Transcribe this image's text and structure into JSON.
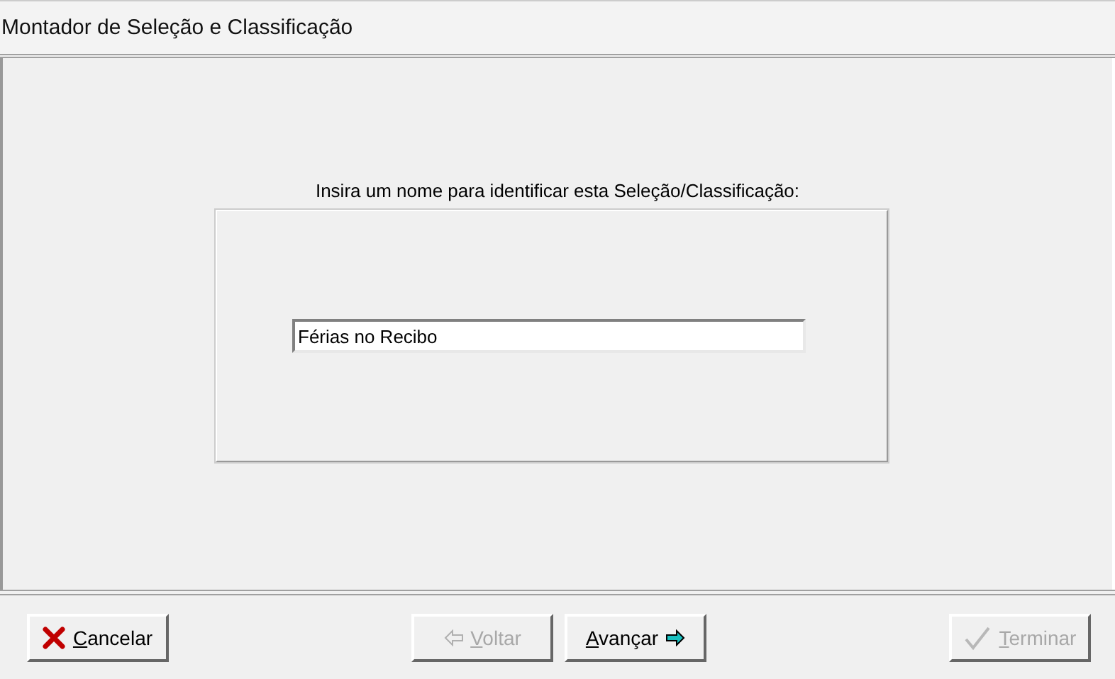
{
  "window": {
    "title": "Montador de Seleção e Classificação"
  },
  "prompt": "Insira um nome para identificar esta Seleção/Classificação:",
  "name_field": {
    "value": "Férias no Recibo"
  },
  "buttons": [
    {
      "label": "Cancelar",
      "kind": "cancel",
      "disabled": false
    },
    {
      "label": "Voltar",
      "kind": "back",
      "disabled": true
    },
    {
      "label": "Avançar",
      "kind": "next",
      "disabled": false
    },
    {
      "label": "Terminar",
      "kind": "finish",
      "disabled": true
    }
  ]
}
